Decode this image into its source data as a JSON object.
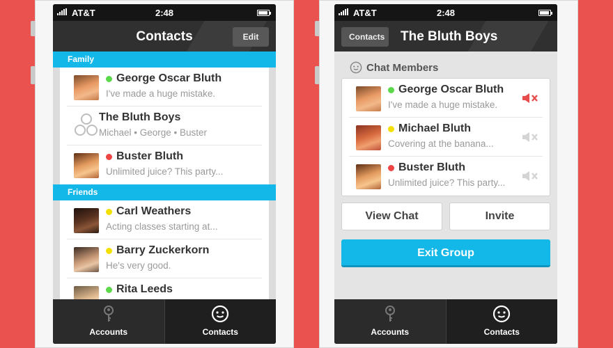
{
  "status": {
    "carrier": "AT&T",
    "time": "2:48"
  },
  "left": {
    "title": "Contacts",
    "edit_label": "Edit",
    "sections": [
      {
        "label": "Family",
        "rows": [
          {
            "name": "George Oscar Bluth",
            "sub": "I've made a huge mistake.",
            "status": "#5bd94a"
          },
          {
            "name": "The Bluth Boys",
            "sub": "Michael • George • Buster",
            "status": ""
          },
          {
            "name": "Buster Bluth",
            "sub": "Unlimited juice? This party...",
            "status": "#ee4444"
          }
        ]
      },
      {
        "label": "Friends",
        "rows": [
          {
            "name": "Carl Weathers",
            "sub": "Acting classes starting at...",
            "status": "#f2e000"
          },
          {
            "name": "Barry Zuckerkorn",
            "sub": "He's very good.",
            "status": "#f2e000"
          },
          {
            "name": "Rita Leeds",
            "sub": "",
            "status": "#5bd94a"
          }
        ]
      }
    ]
  },
  "right": {
    "back_label": "Contacts",
    "title": "The Bluth Boys",
    "members_label": "Chat Members",
    "members": [
      {
        "name": "George Oscar Bluth",
        "sub": "I've made a huge mistake.",
        "status": "#5bd94a",
        "mute_color": "#e84c4c"
      },
      {
        "name": "Michael Bluth",
        "sub": "Covering at the banana...",
        "status": "#f2e000",
        "mute_color": "#d4d4d4"
      },
      {
        "name": "Buster Bluth",
        "sub": "Unlimited juice? This party...",
        "status": "#ee4444",
        "mute_color": "#d4d4d4"
      }
    ],
    "view_chat_label": "View Chat",
    "invite_label": "Invite",
    "exit_label": "Exit Group"
  },
  "tabs": {
    "accounts": "Accounts",
    "contacts": "Contacts"
  },
  "colors": {
    "accent": "#14b8e8",
    "background": "#e9524f"
  }
}
